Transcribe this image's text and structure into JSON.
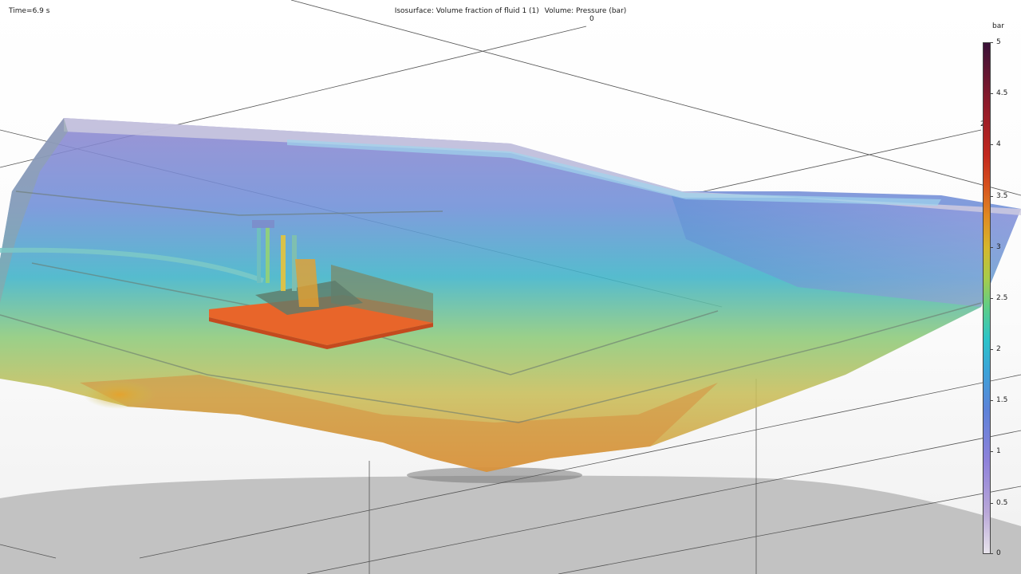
{
  "viewport": {
    "time_label": "Time=6.9 s",
    "title_isosurface": "Isosurface: Volume fraction of fluid 1 (1)",
    "title_volume": "Volume: Pressure (bar)",
    "axis_label_top": "0",
    "axis_label_right": "20"
  },
  "colorbar": {
    "unit": "bar",
    "min": 0,
    "max": 5,
    "ticks": [
      "5",
      "4.5",
      "4",
      "3.5",
      "3",
      "2.5",
      "2",
      "1.5",
      "1",
      "0.5",
      "0"
    ]
  },
  "colors": {
    "low_pressure": "#9a8ad8",
    "mid_pressure": "#2ec4c4",
    "high_pressure": "#e0701e",
    "max_pressure": "#3a1238"
  }
}
